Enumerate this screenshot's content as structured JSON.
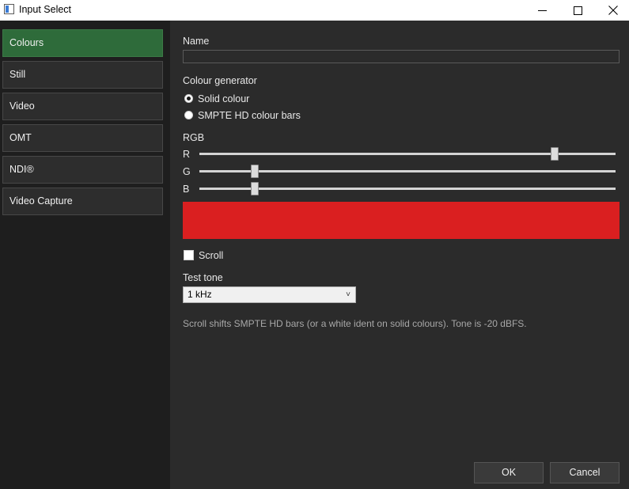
{
  "window": {
    "title": "Input Select",
    "icon": "app-window-icon",
    "controls": [
      "minimize-icon",
      "maximize-icon",
      "close-icon"
    ]
  },
  "sidebar": {
    "items": [
      {
        "label": "Colours",
        "active": true
      },
      {
        "label": "Still",
        "active": false
      },
      {
        "label": "Video",
        "active": false
      },
      {
        "label": "OMT",
        "active": false
      },
      {
        "label": "NDI®",
        "active": false
      },
      {
        "label": "Video Capture",
        "active": false
      }
    ],
    "active_color": "#2e6b3a"
  },
  "form": {
    "name_label": "Name",
    "name_value": "",
    "generator_label": "Colour generator",
    "generator_options": [
      {
        "label": "Solid colour",
        "selected": true
      },
      {
        "label": "SMPTE HD colour bars",
        "selected": false
      }
    ],
    "rgb_label": "RGB",
    "sliders": [
      {
        "label": "R",
        "value": 0.86
      },
      {
        "label": "G",
        "value": 0.125
      },
      {
        "label": "B",
        "value": 0.125
      }
    ],
    "swatch_color": "#da1f20",
    "scroll_label": "Scroll",
    "scroll_checked": false,
    "test_tone_label": "Test tone",
    "test_tone_value": "1 kHz",
    "hint": "Scroll shifts SMPTE HD bars (or a white ident on solid colours). Tone is -20 dBFS."
  },
  "footer": {
    "ok_label": "OK",
    "cancel_label": "Cancel"
  }
}
